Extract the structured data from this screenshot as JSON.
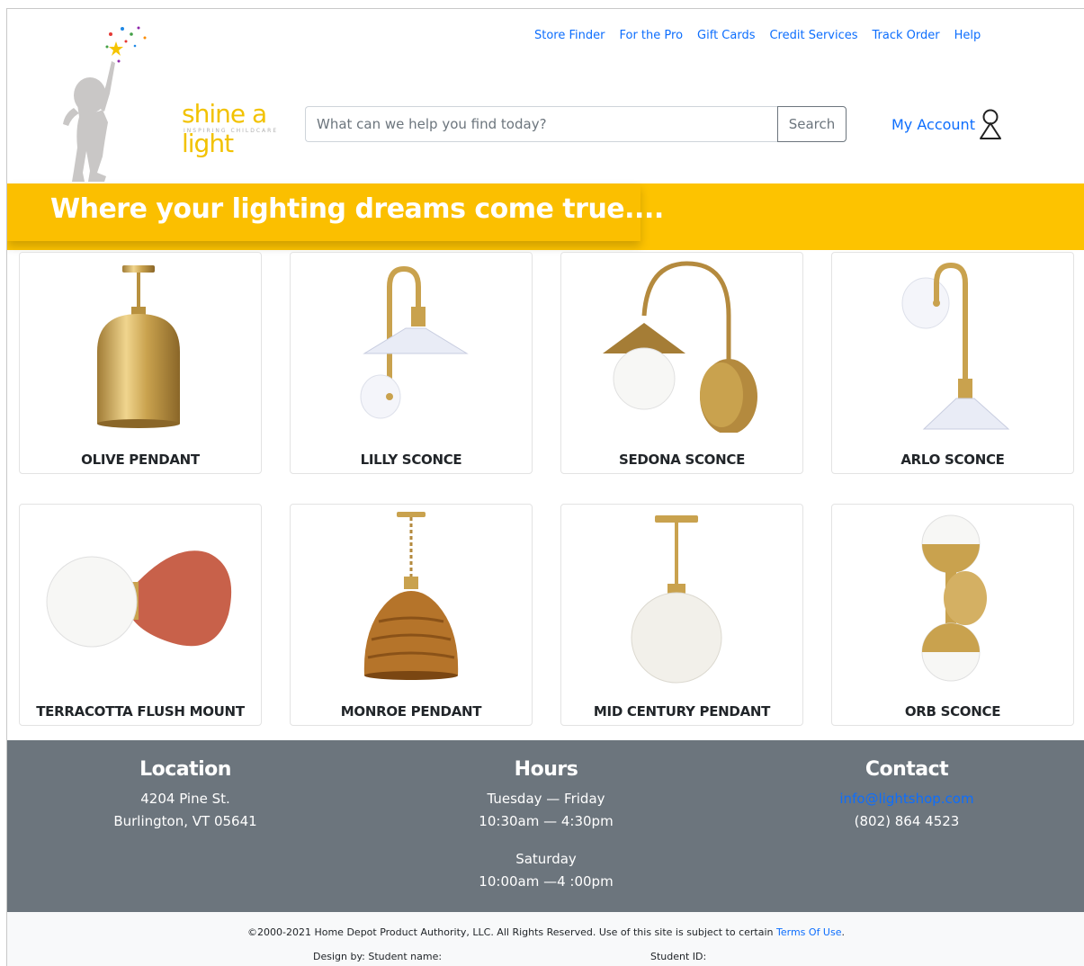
{
  "brand": {
    "name": "shine a light",
    "tagline": "INSPIRING CHILDCARE"
  },
  "top_links": [
    "Store Finder",
    "For the Pro",
    "Gift Cards",
    "Credit Services",
    "Track Order",
    "Help"
  ],
  "search": {
    "placeholder": "What can we help you find today?",
    "button_label": "Search"
  },
  "account": {
    "label": "My Account"
  },
  "banner": {
    "text": "Where your lighting dreams come true....",
    "color": "#fdc300"
  },
  "products": [
    {
      "name": "OLIVE PENDANT"
    },
    {
      "name": "LILLY SCONCE"
    },
    {
      "name": "SEDONA SCONCE"
    },
    {
      "name": "ARLO SCONCE"
    },
    {
      "name": "TERRACOTTA FLUSH MOUNT"
    },
    {
      "name": "MONROE PENDANT"
    },
    {
      "name": "MID CENTURY PENDANT"
    },
    {
      "name": "ORB SCONCE"
    }
  ],
  "footer": {
    "location": {
      "heading": "Location",
      "line1": "4204 Pine St.",
      "line2": "Burlington, VT 05641"
    },
    "hours": {
      "heading": "Hours",
      "line1": "Tuesday — Friday",
      "line2": "10:30am — 4:30pm",
      "line3": "Saturday",
      "line4": "10:00am —4 :00pm"
    },
    "contact": {
      "heading": "Contact",
      "email": "info@lightshop.com",
      "phone": "(802) 864 4523"
    }
  },
  "subfooter": {
    "copyright": "©2000-2021 Home Depot Product Authority, LLC. All Rights Reserved. Use of this site is subject to certain",
    "terms_link": "Terms Of Use",
    "terms_suffix": ".",
    "design_by": "Design by: Student name:",
    "student_id": "Student ID:"
  },
  "colors": {
    "link": "#0d6efd",
    "footer_bg": "#6c757d",
    "banner_yellow": "#fdc300",
    "brass": "#c9a24e"
  }
}
